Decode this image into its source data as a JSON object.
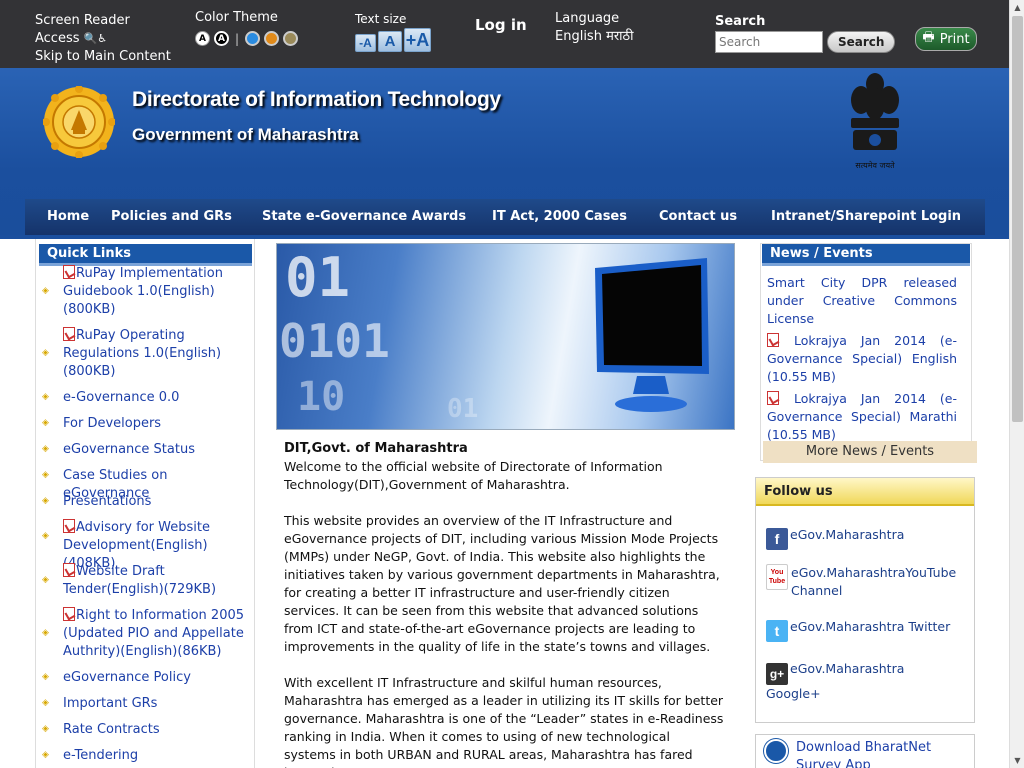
{
  "topbar": {
    "screen_reader": "Screen Reader",
    "access": "Access",
    "skip": "Skip to Main Content",
    "color_theme_label": "Color Theme",
    "color_theme_options": [
      "A",
      "A"
    ],
    "color_theme_separator": "|",
    "color_swatches": [
      "#2a8be0",
      "#e08a1a",
      "#9a8a5a"
    ],
    "text_size_label": "Text size",
    "text_size_options": [
      "-A",
      "A",
      "+A"
    ],
    "login": "Log in",
    "language_label": "Language",
    "language_options": "English मराठी",
    "search_label": "Search",
    "search_placeholder": "Search",
    "search_button": "Search",
    "print_button": "Print"
  },
  "header": {
    "title": "Directorate of Information Technology",
    "subtitle": "Government of Maharashtra",
    "emblem_caption": "सत्यमेव जयते"
  },
  "nav": [
    "Home",
    "Policies and GRs",
    "State e-Governance Awards",
    "IT Act, 2000 Cases",
    "Contact us",
    "Intranet/Sharepoint Login"
  ],
  "quick_links": {
    "title": "Quick Links",
    "items": [
      {
        "label": "RuPay Implementation Guidebook 1.0(English)(800KB)",
        "pdf": true
      },
      {
        "label": "RuPay Operating Regulations 1.0(English)(800KB)",
        "pdf": true
      },
      {
        "label": "e-Governance 0.0",
        "pdf": false
      },
      {
        "label": "For Developers",
        "pdf": false
      },
      {
        "label": "eGovernance Status",
        "pdf": false
      },
      {
        "label": "Case Studies on eGovernance",
        "pdf": false
      },
      {
        "label": "Presentations",
        "pdf": false
      },
      {
        "label": "Advisory for Website Development(English)(408KB)",
        "pdf": true
      },
      {
        "label": "Website Draft Tender(English)(729KB)",
        "pdf": true
      },
      {
        "label": "Right to Information 2005 (Updated PIO and Appellate Authrity)(English)(86KB)",
        "pdf": true
      },
      {
        "label": "eGovernance Policy",
        "pdf": false
      },
      {
        "label": "Important GRs",
        "pdf": false
      },
      {
        "label": "Rate Contracts",
        "pdf": false
      },
      {
        "label": "e-Tendering",
        "pdf": false
      }
    ]
  },
  "banner": {
    "binary_text": [
      "01",
      "0101",
      "10",
      "01"
    ]
  },
  "main": {
    "title": "DIT,Govt. of Maharashtra",
    "intro": "Welcome to the official website of Directorate of Information Technology(DIT),Government of Maharashtra.",
    "para1": "This website provides an overview of the IT Infrastructure and eGovernance projects of DIT, including various Mission Mode Projects (MMPs) under NeGP, Govt. of India. This website also highlights the initiatives taken by various government departments in Maharashtra, for creating a better IT infrastructure and user-friendly citizen services. It can be seen from this website that advanced solutions from ICT and state-of-the-art eGovernance projects are leading to improvements in the quality of life in the state’s towns and villages.",
    "para2": "With excellent IT Infrastructure and skilful human resources, Maharashtra has emerged as a leader in utilizing its IT skills for better governance. Maharashtra is one of the “Leader” states in e-Readiness ranking in India. When it comes to using of new technological systems in both URBAN and RURAL areas, Maharashtra has fared better than"
  },
  "news": {
    "title": "News / Events",
    "items": [
      {
        "label": "Smart City DPR released under Creative Commons License",
        "pdf": false
      },
      {
        "label": "Lokrajya Jan 2014 (e-Governance Special) English (10.55 MB)",
        "pdf": true
      },
      {
        "label": "Lokrajya Jan 2014 (e-Governance Special) Marathi (10.55 MB)",
        "pdf": true
      }
    ],
    "more": "More News / Events"
  },
  "follow": {
    "title": "Follow us",
    "facebook": "eGov.Maharashtra",
    "youtube": "eGov.MaharashtraYouTube Channel",
    "twitter": "eGov.Maharashtra Twitter",
    "gplus": "eGov.Maharashtra Google+",
    "youtube_icon_text": "You Tube",
    "gplus_icon_text": "g+"
  },
  "bharatnet": "Download BharatNet Survey App"
}
